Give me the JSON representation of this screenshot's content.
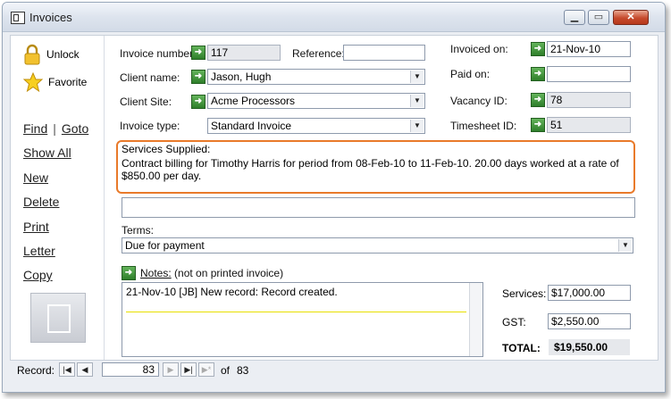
{
  "window": {
    "title": "Invoices"
  },
  "sidebar": {
    "unlock_label": "Unlock",
    "favorite_label": "Favorite",
    "find_label": "Find",
    "goto_label": "Goto",
    "show_all_label": "Show All",
    "new_label": "New",
    "delete_label": "Delete",
    "print_label": "Print",
    "letter_label": "Letter",
    "copy_label": "Copy"
  },
  "form": {
    "invoice_number_label": "Invoice number:",
    "invoice_number": "117",
    "reference_label": "Reference:",
    "reference": "",
    "invoiced_on_label": "Invoiced on:",
    "invoiced_on": "21-Nov-10",
    "client_name_label": "Client name:",
    "client_name": "Jason, Hugh",
    "paid_on_label": "Paid on:",
    "paid_on": "",
    "client_site_label": "Client Site:",
    "client_site": "Acme Processors",
    "vacancy_id_label": "Vacancy ID:",
    "vacancy_id": "78",
    "invoice_type_label": "Invoice type:",
    "invoice_type": "Standard Invoice",
    "timesheet_id_label": "Timesheet ID:",
    "timesheet_id": "51",
    "services_label": "Services Supplied:",
    "services_text": "Contract billing for Timothy Harris for period from 08-Feb-10 to 11-Feb-10. 20.00 days worked at a rate of $850.00 per day.",
    "terms_label": "Terms:",
    "terms": "Due for payment",
    "notes_label": "Notes:",
    "notes_sublabel": "(not on printed invoice)",
    "notes_text": "21-Nov-10 [JB] New record: Record created.",
    "services_total_label": "Services:",
    "services_total": "$17,000.00",
    "gst_label": "GST:",
    "gst": "$2,550.00",
    "total_label": "TOTAL:",
    "total": "$19,550.00"
  },
  "navigation": {
    "record_label": "Record:",
    "current": "83",
    "of_label": "of",
    "count": "83"
  },
  "colors": {
    "highlight": "#e97a2a",
    "go_button": "#3c9135"
  }
}
